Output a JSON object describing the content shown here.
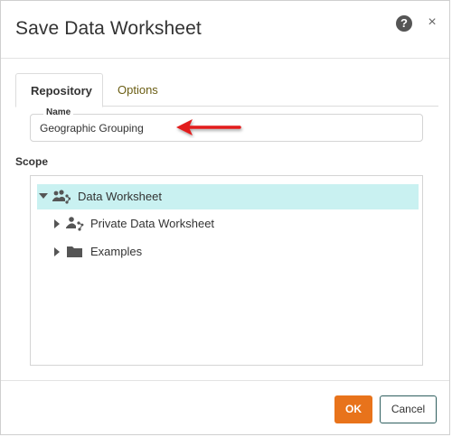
{
  "dialog": {
    "title": "Save Data Worksheet",
    "help_icon": "help-circle-icon",
    "help_glyph": "?",
    "close_icon": "close-icon",
    "close_glyph": "×"
  },
  "tabs": [
    {
      "label": "Repository",
      "active": true
    },
    {
      "label": "Options",
      "active": false
    }
  ],
  "name_field": {
    "label": "Name",
    "value": "Geographic Grouping"
  },
  "annotation": {
    "icon": "red-arrow-icon",
    "color": "#e21b1b"
  },
  "scope": {
    "label": "Scope",
    "tree": [
      {
        "label": "Data Worksheet",
        "icon": "worksheet-group-icon",
        "expanded": true,
        "selected": true,
        "level": 0
      },
      {
        "label": "Private Data Worksheet",
        "icon": "worksheet-private-icon",
        "expanded": false,
        "selected": false,
        "level": 1
      },
      {
        "label": "Examples",
        "icon": "folder-icon",
        "expanded": false,
        "selected": false,
        "level": 1
      }
    ]
  },
  "footer": {
    "ok_label": "OK",
    "cancel_label": "Cancel"
  },
  "colors": {
    "accent": "#e8731b",
    "selection": "#c9f1f1",
    "tab_inactive_text": "#6b5e14",
    "cancel_border": "#2f5f5f"
  }
}
